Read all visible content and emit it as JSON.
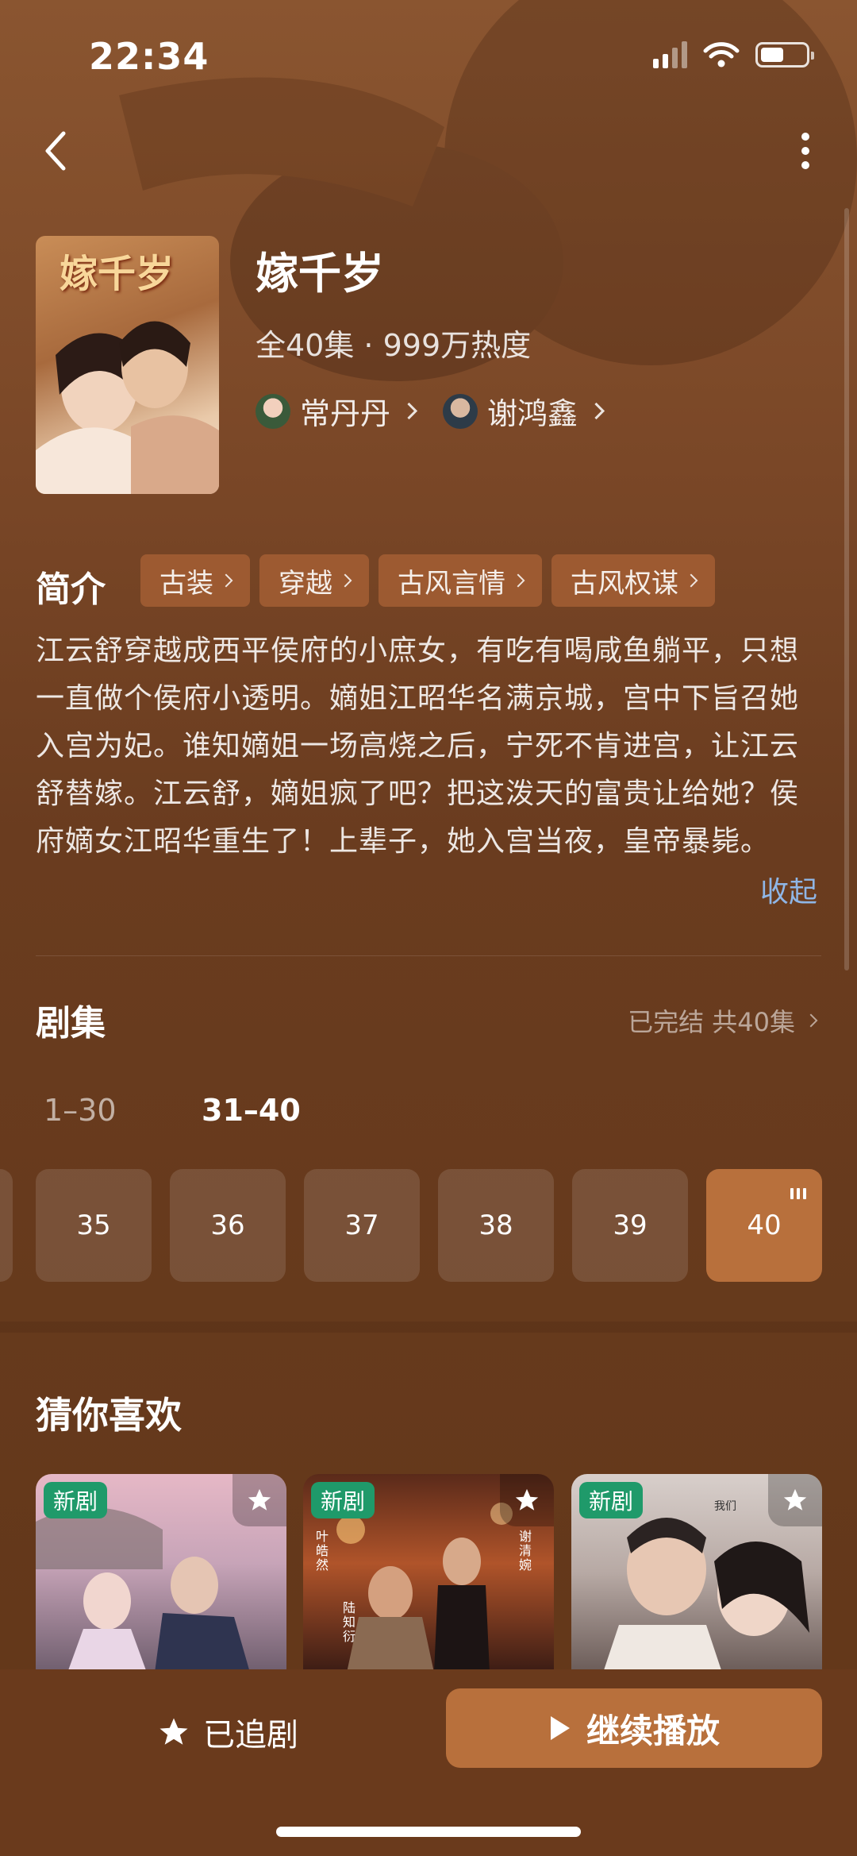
{
  "status_bar": {
    "time": "22:34"
  },
  "drama": {
    "title": "嫁千岁",
    "poster_text": "嫁千岁",
    "meta": "全40集 · 999万热度",
    "actors": [
      {
        "name": "常丹丹"
      },
      {
        "name": "谢鸿鑫"
      }
    ]
  },
  "intro": {
    "heading": "简介",
    "tags": [
      "古装",
      "穿越",
      "古风言情",
      "古风权谋"
    ],
    "description": "江云舒穿越成西平侯府的小庶女，有吃有喝咸鱼躺平，只想一直做个侯府小透明。嫡姐江昭华名满京城，宫中下旨召她入宫为妃。谁知嫡姐一场高烧之后，宁死不肯进宫，让江云舒替嫁。江云舒，嫡姐疯了吧？把这泼天的富贵让给她？侯府嫡女江昭华重生了！上辈子，她入宫当夜，皇帝暴毙。",
    "collapse_label": "收起"
  },
  "episodes": {
    "heading": "剧集",
    "status": "已完结 共40集",
    "ranges": [
      "1–30",
      "31–40"
    ],
    "items": [
      "35",
      "36",
      "37",
      "38",
      "39",
      "40"
    ],
    "current": "40"
  },
  "recommend": {
    "heading": "猜你喜欢",
    "badge": "新剧",
    "poster_texts": [
      "叶皓然",
      "陆知衍",
      "谢清婉",
      "我们"
    ]
  },
  "bottom": {
    "follow_label": "已追剧",
    "play_label": "继续播放"
  },
  "colors": {
    "accent": "#b8703c",
    "link": "#8fb6e6",
    "badge": "#1f9a6a"
  }
}
